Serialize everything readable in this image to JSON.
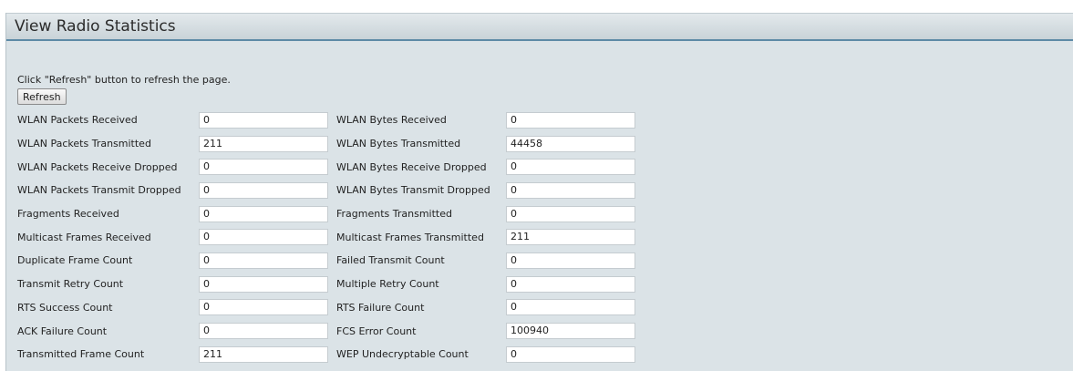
{
  "header": {
    "title": "View Radio Statistics"
  },
  "hint": "Click \"Refresh\" button to refresh the page.",
  "refresh_label": "Refresh",
  "rows": [
    {
      "l1": "WLAN Packets Received",
      "v1": "0",
      "l2": "WLAN Bytes Received",
      "v2": "0"
    },
    {
      "l1": "WLAN Packets Transmitted",
      "v1": "211",
      "l2": "WLAN Bytes Transmitted",
      "v2": "44458"
    },
    {
      "l1": "WLAN Packets Receive Dropped",
      "v1": "0",
      "l2": "WLAN Bytes Receive Dropped",
      "v2": "0"
    },
    {
      "l1": "WLAN Packets Transmit Dropped",
      "v1": "0",
      "l2": "WLAN Bytes Transmit Dropped",
      "v2": "0"
    },
    {
      "l1": "Fragments Received",
      "v1": "0",
      "l2": "Fragments Transmitted",
      "v2": "0"
    },
    {
      "l1": "Multicast Frames Received",
      "v1": "0",
      "l2": "Multicast Frames Transmitted",
      "v2": "211"
    },
    {
      "l1": "Duplicate Frame Count",
      "v1": "0",
      "l2": "Failed Transmit Count",
      "v2": "0"
    },
    {
      "l1": "Transmit Retry Count",
      "v1": "0",
      "l2": "Multiple Retry Count",
      "v2": "0"
    },
    {
      "l1": "RTS Success Count",
      "v1": "0",
      "l2": "RTS Failure Count",
      "v2": "0"
    },
    {
      "l1": "ACK Failure Count",
      "v1": "0",
      "l2": "FCS Error Count",
      "v2": "100940"
    },
    {
      "l1": "Transmitted Frame Count",
      "v1": "211",
      "l2": "WEP Undecryptable Count",
      "v2": "0"
    }
  ]
}
